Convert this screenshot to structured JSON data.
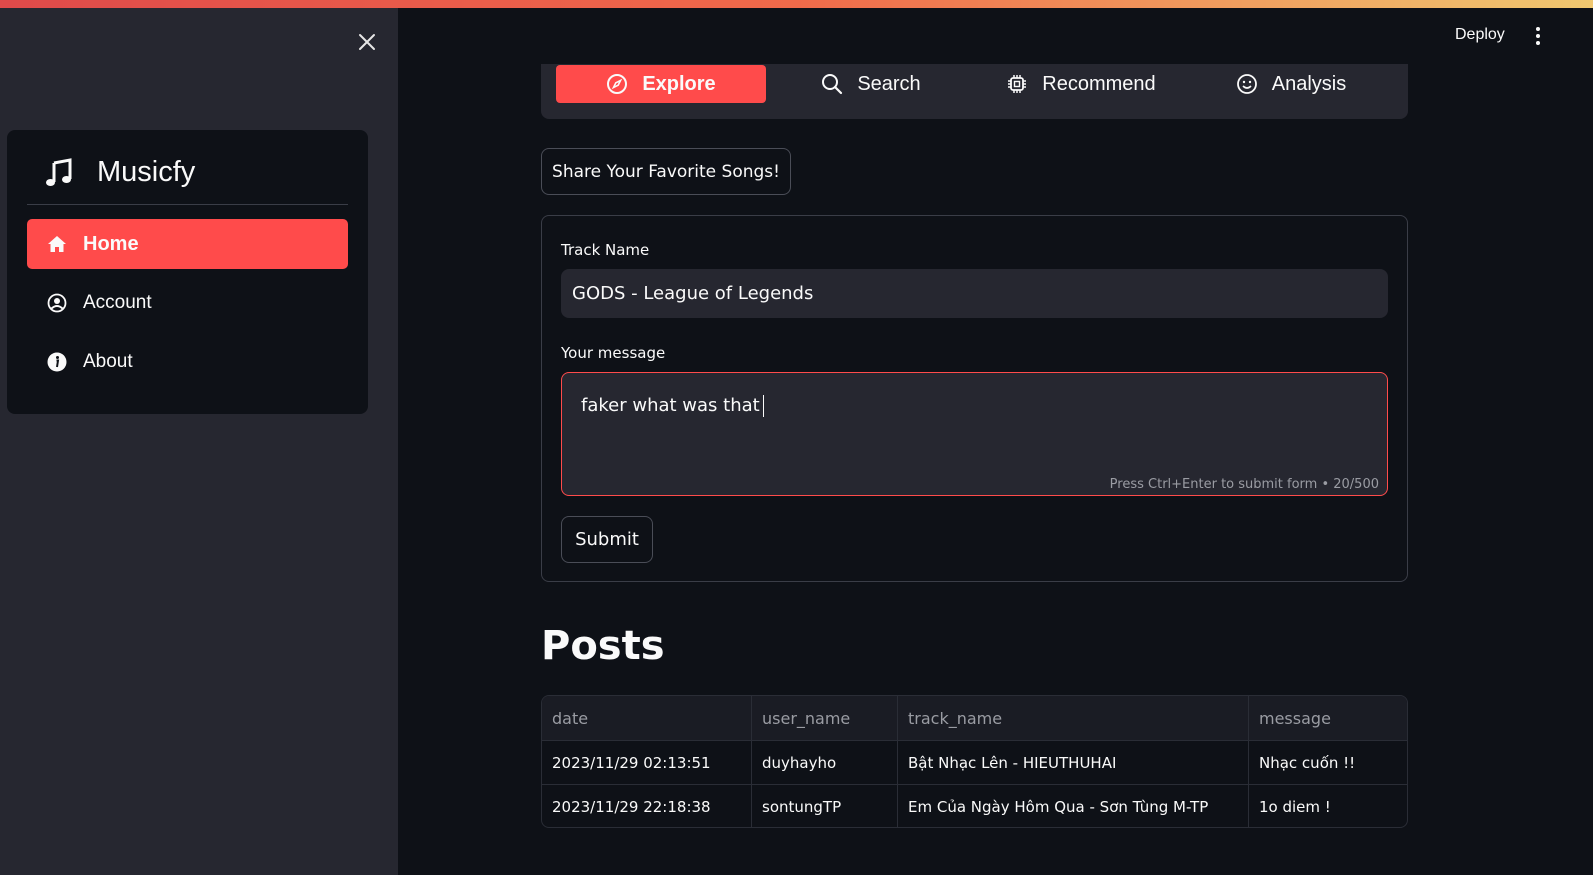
{
  "header": {
    "deploy_label": "Deploy"
  },
  "sidebar": {
    "brand": "Musicfy",
    "items": [
      {
        "label": "Home",
        "icon": "house-icon",
        "active": true
      },
      {
        "label": "Account",
        "icon": "user-circle-icon",
        "active": false
      },
      {
        "label": "About",
        "icon": "info-circle-icon",
        "active": false
      }
    ]
  },
  "tabs": [
    {
      "label": "Explore",
      "icon": "compass-icon",
      "active": true
    },
    {
      "label": "Search",
      "icon": "search-icon",
      "active": false
    },
    {
      "label": "Recommend",
      "icon": "cpu-icon",
      "active": false
    },
    {
      "label": "Analysis",
      "icon": "smile-icon",
      "active": false
    }
  ],
  "share_button": "Share Your Favorite Songs!",
  "form": {
    "track_label": "Track Name",
    "track_value": "GODS - League of Legends",
    "message_label": "Your message",
    "message_value": "faker what was that",
    "hint": "Press Ctrl+Enter to submit form  •  20/500",
    "submit_label": "Submit"
  },
  "posts": {
    "title": "Posts",
    "columns": [
      "date",
      "user_name",
      "track_name",
      "message"
    ],
    "rows": [
      [
        "2023/11/29 02:13:51",
        "duyhayho",
        "Bật Nhạc Lên - HIEUTHUHAI",
        "Nhạc cuốn !!"
      ],
      [
        "2023/11/29 22:18:38",
        "sontungTP",
        "Em Của Ngày Hôm Qua - Sơn Tùng M-TP",
        "1o diem !"
      ]
    ]
  },
  "colors": {
    "accent": "#ff4b4b",
    "background": "#0e1117",
    "sidebar": "#262730"
  }
}
